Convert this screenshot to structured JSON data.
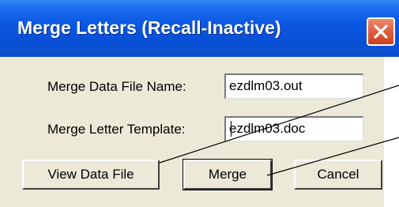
{
  "dialog": {
    "title": "Merge Letters (Recall-Inactive)",
    "close_icon": "close-icon"
  },
  "fields": {
    "data_file": {
      "label": "Merge Data File Name:",
      "value": "ezdlm03.out"
    },
    "template": {
      "label": "Merge Letter Template:",
      "value": "ezdlm03.doc"
    }
  },
  "buttons": {
    "view": "View Data File",
    "merge": "Merge",
    "cancel": "Cancel"
  },
  "colors": {
    "titlebar": "#0a58e0",
    "dialog_bg": "#ece9d8",
    "close_button": "#d9573a"
  }
}
